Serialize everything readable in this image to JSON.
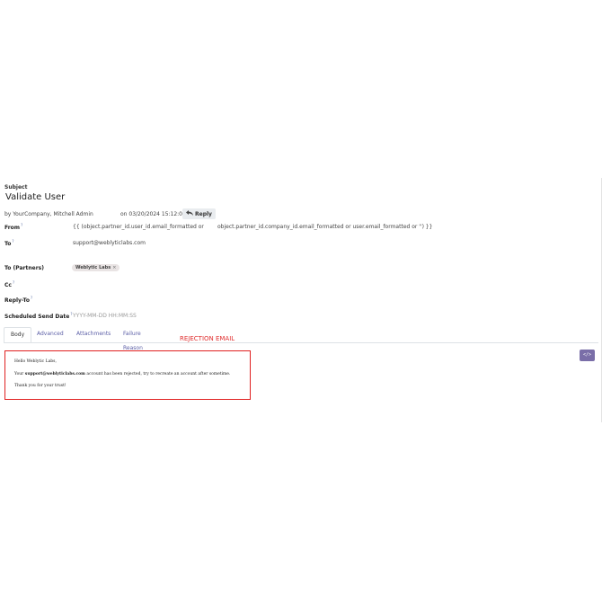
{
  "subject": {
    "label": "Subject",
    "value": "Validate User"
  },
  "meta": {
    "by_prefix": "by",
    "author": "YourCompany, Mitchell Admin",
    "date": "on 03/20/2024 15:12:01",
    "reply_label": "Reply"
  },
  "from": {
    "label": "From",
    "help": "?",
    "value_part1": "{{ (object.partner_id.user_id.email_formatted or",
    "value_part2": "object.partner_id.company_id.email_formatted or user.email_formatted or '') }}"
  },
  "to": {
    "label": "To",
    "help": "?",
    "value": "support@weblyticlabs.com"
  },
  "to_partners": {
    "label": "To (Partners)",
    "tags": [
      "Weblytic Labs"
    ],
    "tag_remove": "×"
  },
  "cc": {
    "label": "Cc",
    "help": "?"
  },
  "reply_to": {
    "label": "Reply-To",
    "help": "?"
  },
  "scheduled": {
    "label": "Scheduled Send Date",
    "help": "?",
    "placeholder": "YYYY-MM-DD HH:MM:SS"
  },
  "tabs": [
    {
      "label": "Body",
      "active": true
    },
    {
      "label": "Advanced"
    },
    {
      "label": "Attachments"
    },
    {
      "label": "Failure Reason"
    }
  ],
  "annotation": "REJECTION EMAIL",
  "code_view": "</>",
  "body": {
    "greeting": "Hello Weblytic Labs,",
    "line2_prefix": "Your",
    "line2_email": "support@weblyticlabs.com",
    "line2_suffix": "account has been rejected, try to recreate an account after sometime.",
    "thanks": "Thank you for your trust!"
  },
  "colors": {
    "annotation": "#e03030",
    "box_border": "#e02020",
    "tab_link": "#5b5ea6",
    "code_button": "#7a6ea8"
  }
}
